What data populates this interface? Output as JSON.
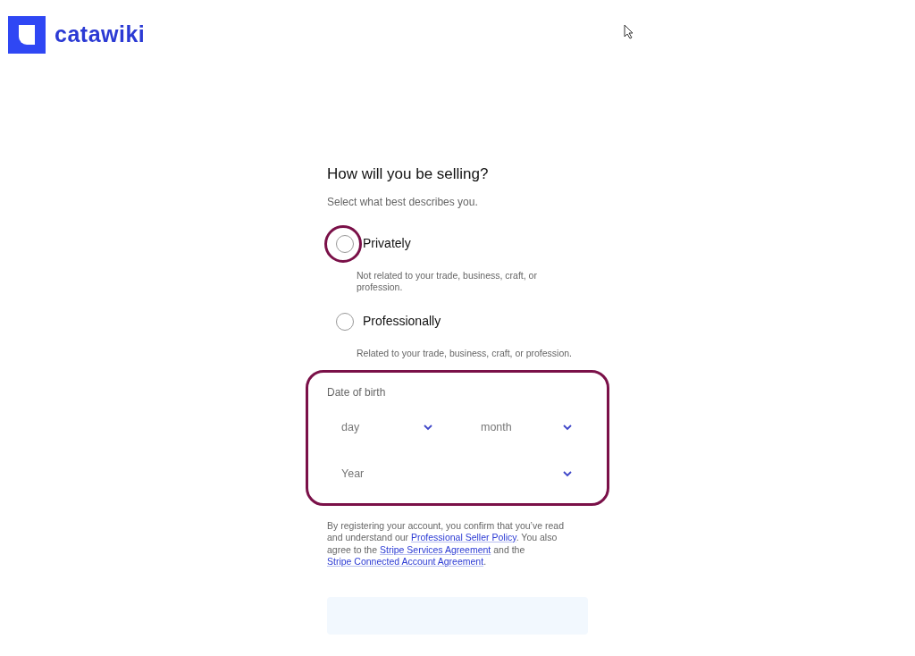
{
  "logo": {
    "text": "catawiki"
  },
  "heading": "How will you be selling?",
  "subheading": "Select what best describes you.",
  "options": [
    {
      "label": "Privately",
      "description": "Not related to your trade, business, craft, or profession.",
      "selected": false,
      "highlighted": true
    },
    {
      "label": "Professionally",
      "description": "Related to your trade, business, craft, or profession.",
      "selected": false,
      "highlighted": false
    }
  ],
  "date_of_birth": {
    "label": "Date of birth",
    "highlighted": true,
    "selects": [
      {
        "placeholder": "day"
      },
      {
        "placeholder": "month"
      },
      {
        "placeholder": "Year"
      }
    ]
  },
  "legal": [
    {
      "kind": "text",
      "text": "By registering your account, you confirm that you’ve read and understand our "
    },
    {
      "kind": "link",
      "text": "Professional Seller Policy"
    },
    {
      "kind": "text",
      "text": ". You also agree to the "
    },
    {
      "kind": "link",
      "text": "Stripe Services Agreement"
    },
    {
      "kind": "text",
      "text": " and the "
    },
    {
      "kind": "link",
      "text": "Stripe Connected Account Agreement"
    },
    {
      "kind": "text",
      "text": "."
    }
  ],
  "submit": {
    "disabled": true
  }
}
